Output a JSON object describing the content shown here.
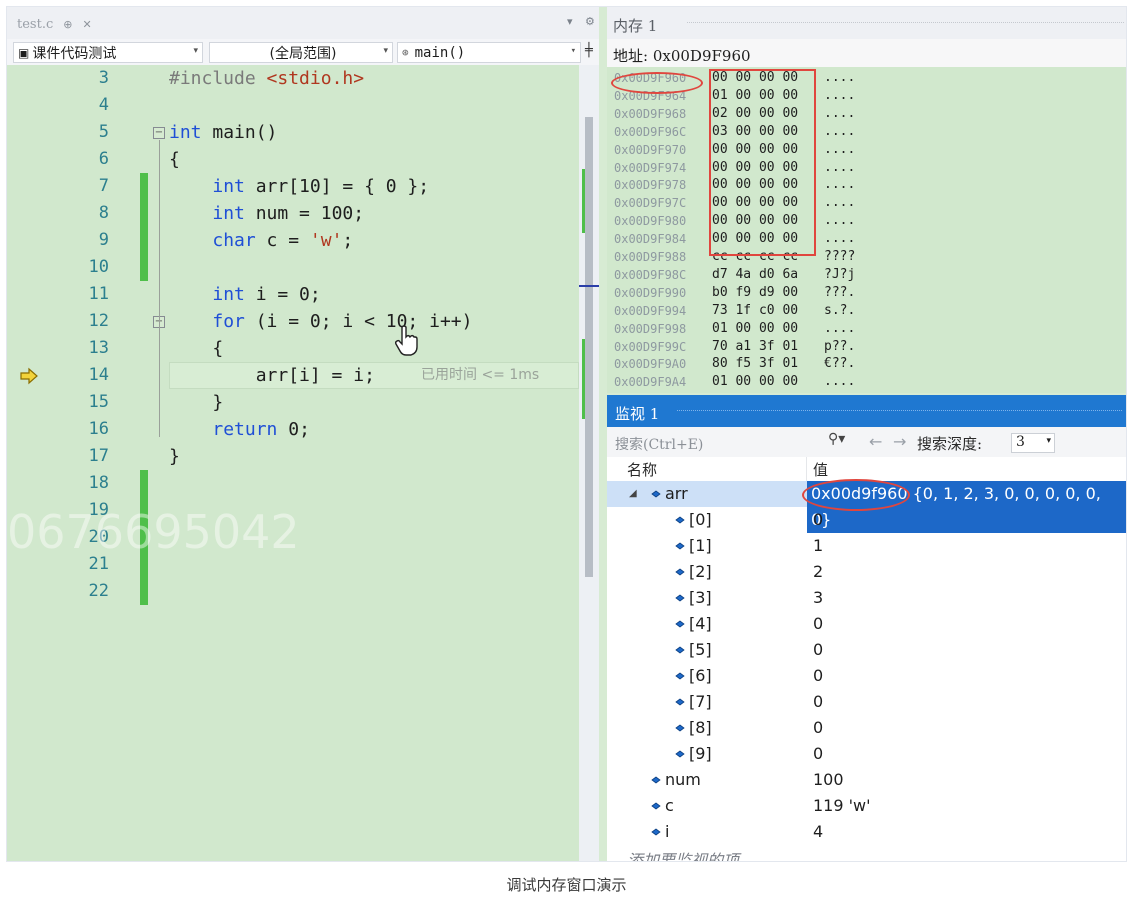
{
  "editor": {
    "file_tab": "test.c",
    "nav": {
      "project": "课件代码测试",
      "scope": "(全局范围)",
      "function": "main()"
    },
    "lines": [
      {
        "num": "3",
        "parts": [
          [
            "pp",
            "#include "
          ],
          [
            "str",
            "<stdio.h>"
          ]
        ]
      },
      {
        "num": "4",
        "parts": []
      },
      {
        "num": "5",
        "parts": [
          [
            "kw",
            "int"
          ],
          [
            "",
            " main()"
          ]
        ]
      },
      {
        "num": "6",
        "parts": [
          [
            "",
            "{"
          ]
        ]
      },
      {
        "num": "7",
        "parts": [
          [
            "",
            "    "
          ],
          [
            "kw",
            "int"
          ],
          [
            "",
            " arr[10] = { 0 };"
          ]
        ]
      },
      {
        "num": "8",
        "parts": [
          [
            "",
            "    "
          ],
          [
            "kw",
            "int"
          ],
          [
            "",
            " num = 100;"
          ]
        ]
      },
      {
        "num": "9",
        "parts": [
          [
            "",
            "    "
          ],
          [
            "kw",
            "char"
          ],
          [
            "",
            " c = "
          ],
          [
            "str",
            "'w'"
          ],
          [
            "",
            ";"
          ]
        ]
      },
      {
        "num": "10",
        "parts": []
      },
      {
        "num": "11",
        "parts": [
          [
            "",
            "    "
          ],
          [
            "kw",
            "int"
          ],
          [
            "",
            " i = 0;"
          ]
        ]
      },
      {
        "num": "12",
        "parts": [
          [
            "",
            "    "
          ],
          [
            "kw",
            "for"
          ],
          [
            "",
            " (i = 0; i < 10; i++)"
          ]
        ]
      },
      {
        "num": "13",
        "parts": [
          [
            "",
            "    {"
          ]
        ]
      },
      {
        "num": "14",
        "parts": [
          [
            "",
            "        arr[i] = i;"
          ]
        ]
      },
      {
        "num": "15",
        "parts": [
          [
            "",
            "    }"
          ]
        ]
      },
      {
        "num": "16",
        "parts": [
          [
            "",
            "    "
          ],
          [
            "kw",
            "return"
          ],
          [
            "",
            " 0;"
          ]
        ]
      },
      {
        "num": "17",
        "parts": [
          [
            "",
            "}"
          ]
        ]
      },
      {
        "num": "18",
        "parts": []
      },
      {
        "num": "19",
        "parts": []
      },
      {
        "num": "20",
        "parts": []
      },
      {
        "num": "21",
        "parts": []
      },
      {
        "num": "22",
        "parts": []
      }
    ],
    "elapsed_hint": "已用时间 <= 1ms",
    "current_line": "14",
    "watermark": "0676695042"
  },
  "memory": {
    "title": "内存 1",
    "address_label": "地址:",
    "address_value": "0x00D9F960",
    "rows": [
      {
        "addr": "0x00D9F960",
        "bytes": "00 00 00 00",
        "ascii": "...."
      },
      {
        "addr": "0x00D9F964",
        "bytes": "01 00 00 00",
        "ascii": "...."
      },
      {
        "addr": "0x00D9F968",
        "bytes": "02 00 00 00",
        "ascii": "...."
      },
      {
        "addr": "0x00D9F96C",
        "bytes": "03 00 00 00",
        "ascii": "...."
      },
      {
        "addr": "0x00D9F970",
        "bytes": "00 00 00 00",
        "ascii": "...."
      },
      {
        "addr": "0x00D9F974",
        "bytes": "00 00 00 00",
        "ascii": "...."
      },
      {
        "addr": "0x00D9F978",
        "bytes": "00 00 00 00",
        "ascii": "...."
      },
      {
        "addr": "0x00D9F97C",
        "bytes": "00 00 00 00",
        "ascii": "...."
      },
      {
        "addr": "0x00D9F980",
        "bytes": "00 00 00 00",
        "ascii": "...."
      },
      {
        "addr": "0x00D9F984",
        "bytes": "00 00 00 00",
        "ascii": "...."
      },
      {
        "addr": "0x00D9F988",
        "bytes": "cc cc cc cc",
        "ascii": "????"
      },
      {
        "addr": "0x00D9F98C",
        "bytes": "d7 4a d0 6a",
        "ascii": "?J?j"
      },
      {
        "addr": "0x00D9F990",
        "bytes": "b0 f9 d9 00",
        "ascii": "???."
      },
      {
        "addr": "0x00D9F994",
        "bytes": "73 1f c0 00",
        "ascii": "s.?."
      },
      {
        "addr": "0x00D9F998",
        "bytes": "01 00 00 00",
        "ascii": "...."
      },
      {
        "addr": "0x00D9F99C",
        "bytes": "70 a1 3f 01",
        "ascii": "p??."
      },
      {
        "addr": "0x00D9F9A0",
        "bytes": "80 f5 3f 01",
        "ascii": "€??."
      },
      {
        "addr": "0x00D9F9A4",
        "bytes": "01 00 00 00",
        "ascii": "...."
      }
    ]
  },
  "watch": {
    "title": "监视 1",
    "search_placeholder": "搜索(Ctrl+E)",
    "depth_label": "搜索深度:",
    "depth_value": "3",
    "col_name": "名称",
    "col_value": "值",
    "rows": [
      {
        "name": "arr",
        "value": "0x00d9f960 {0, 1, 2, 3, 0, 0, 0, 0, 0, 0}",
        "level": 0,
        "expanded": true,
        "selected": true
      },
      {
        "name": "[0]",
        "value": "0",
        "level": 1
      },
      {
        "name": "[1]",
        "value": "1",
        "level": 1
      },
      {
        "name": "[2]",
        "value": "2",
        "level": 1
      },
      {
        "name": "[3]",
        "value": "3",
        "level": 1
      },
      {
        "name": "[4]",
        "value": "0",
        "level": 1
      },
      {
        "name": "[5]",
        "value": "0",
        "level": 1
      },
      {
        "name": "[6]",
        "value": "0",
        "level": 1
      },
      {
        "name": "[7]",
        "value": "0",
        "level": 1
      },
      {
        "name": "[8]",
        "value": "0",
        "level": 1
      },
      {
        "name": "[9]",
        "value": "0",
        "level": 1
      },
      {
        "name": "num",
        "value": "100",
        "level": 0
      },
      {
        "name": "c",
        "value": "119 'w'",
        "level": 0
      },
      {
        "name": "i",
        "value": "4",
        "level": 0
      }
    ],
    "add_item": "添加要监视的项"
  },
  "caption": "调试内存窗口演示",
  "colors": {
    "annotation": "#e0463e",
    "selection": "#1d68c8",
    "watch_title": "#1f78d1",
    "editor_bg": "#d1e8cd"
  }
}
